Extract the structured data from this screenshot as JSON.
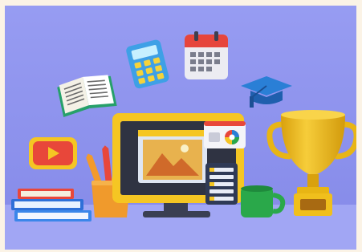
{
  "image": {
    "kind": "3d-illustration",
    "frame_color": "#fbf3e6",
    "colors": {
      "background": "#8d92ec",
      "floor": "#9fa4f2",
      "monitor_yellow": "#f5c623",
      "trophy_gold": "#e8b514",
      "play_red": "#e8473a",
      "cup_green": "#2aa84a",
      "cap_blue": "#2a7fd6",
      "books_blue": "#2f6fd8",
      "calculator_blue": "#3ea0e6"
    },
    "objects": [
      {
        "name": "calculator-icon"
      },
      {
        "name": "calendar-icon"
      },
      {
        "name": "open-book-icon"
      },
      {
        "name": "graduation-cap-icon"
      },
      {
        "name": "play-button-icon"
      },
      {
        "name": "trophy-icon"
      },
      {
        "name": "desktop-monitor"
      },
      {
        "name": "image-landscape-icon"
      },
      {
        "name": "color-picker-panel"
      },
      {
        "name": "layers-panel"
      },
      {
        "name": "pencil-cup"
      },
      {
        "name": "coffee-mug"
      },
      {
        "name": "book-stack"
      }
    ]
  }
}
